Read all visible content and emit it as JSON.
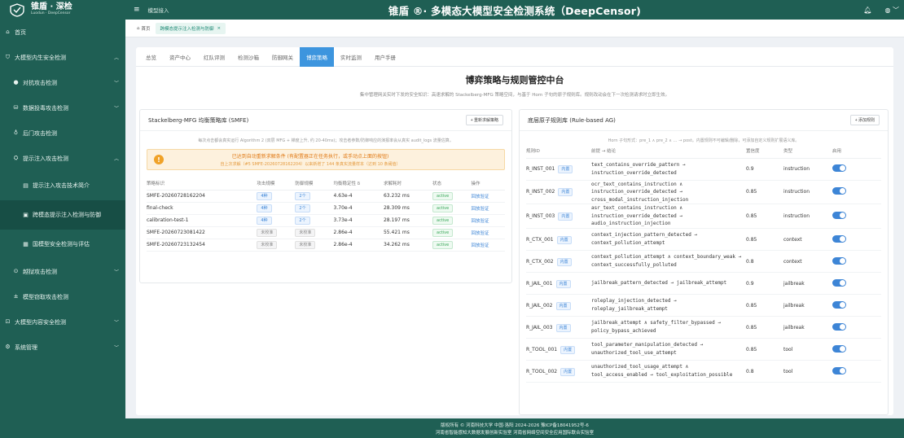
{
  "logo": {
    "title": "锥盾 · 深检",
    "subtitle": "Luodun · DeepCensor"
  },
  "sidebar": {
    "items": [
      {
        "label": "首页",
        "icon": "home-icon"
      },
      {
        "label": "大模型内生安全检测",
        "icon": "shield-icon"
      },
      {
        "label": "对抗攻击检测",
        "icon": "target-icon"
      },
      {
        "label": "数据投毒攻击检测",
        "icon": "database-icon"
      },
      {
        "label": "后门攻击检测",
        "icon": "backdoor-icon"
      },
      {
        "label": "提示注入攻击检测",
        "icon": "inject-icon"
      },
      {
        "label": "提示注入攻击技术简介",
        "icon": "doc-icon"
      },
      {
        "label": "跨模态提示注入检测与防御",
        "icon": "monitor-icon"
      },
      {
        "label": "国模型安全检测与评估",
        "icon": "grid-icon"
      },
      {
        "label": "越狱攻击检测",
        "icon": "lock-icon"
      },
      {
        "label": "模型窃取攻击检测",
        "icon": "steal-icon"
      },
      {
        "label": "大模型内容安全检测",
        "icon": "content-icon"
      },
      {
        "label": "系统管理",
        "icon": "settings-icon"
      }
    ]
  },
  "topbar": {
    "crumb": "模型接入",
    "title": "锥盾 ®· 多模态大模型安全检测系统（DeepCensor)"
  },
  "tabstrip": {
    "home": "首页",
    "active_tab": "跨模态提示注入检测与防御"
  },
  "navtabs": [
    "总览",
    "资产中心",
    "红队评测",
    "检测沙箱",
    "防御网关",
    "博弈策略",
    "实时监测",
    "用户手册"
  ],
  "section": {
    "title": "博弈策略与规则管控中台",
    "desc": "集中管理网关实时下发的安全知识：高速求解的 Stackelberg-MFG 策略空间，与基于 Horn 子句的原子规则库。规则改动会在下一次检测请求时立即生效。"
  },
  "left_panel": {
    "title": "Stackelberg-MFG 均衡策略库 (SMFE)",
    "button": "+ 重新求解策略",
    "note": "每次点击都会真实运行 Algorithm 2 (双层 MFG + 梯度上升, 约 20-40ms)；攻击者参数/防御响应的演报率会从真实 audit_logs 流量估算。",
    "alert_l1": "已达到自动重新求解条件 (有配置器正在任务执行，或手动点上面的按钮)",
    "alert_l2": "自上次求解（#5 SMFE-20260728162204）以来新增了 144 条真实流量样本（达到 10 条阈值）",
    "columns": [
      "策略标识",
      "攻击规模",
      "防御规模",
      "均衡稳定性 δ",
      "求解耗时",
      "状态",
      "操作"
    ],
    "rows": [
      {
        "id": "SMFE-20260728162204",
        "atk": "4种",
        "def": "2个",
        "delta": "4.63e-4",
        "time": "63.232 ms",
        "status": "active",
        "action": "回放验证",
        "atk_tag": "blue",
        "def_tag": "blue"
      },
      {
        "id": "final-check",
        "atk": "4种",
        "def": "2个",
        "delta": "3.70e-4",
        "time": "28.309 ms",
        "status": "active",
        "action": "回放验证",
        "atk_tag": "blue",
        "def_tag": "blue"
      },
      {
        "id": "calibration-test-1",
        "atk": "4种",
        "def": "2个",
        "delta": "3.73e-4",
        "time": "28.197 ms",
        "status": "active",
        "action": "回放验证",
        "atk_tag": "blue",
        "def_tag": "blue"
      },
      {
        "id": "SMFE-20260723081422",
        "atk": "未校准",
        "def": "未校准",
        "delta": "2.86e-4",
        "time": "55.421 ms",
        "status": "active",
        "action": "回放验证",
        "atk_tag": "gray",
        "def_tag": "gray"
      },
      {
        "id": "SMFE-20260723132454",
        "atk": "未校准",
        "def": "未校准",
        "delta": "2.86e-4",
        "time": "34.262 ms",
        "status": "active",
        "action": "回放验证",
        "atk_tag": "gray",
        "def_tag": "gray"
      }
    ]
  },
  "right_panel": {
    "title": "底层原子规则库 (Rule-based AG)",
    "button": "+ 添加规则",
    "note": "Horn 子句形式：pre_1 ∧ pre_2 ∧ … → post。内置规则不可编辑/删除，可添加自定义规则扩展语义库。",
    "columns": [
      "规则ID",
      "前提 → 结论",
      "置信度",
      "类型",
      "启用"
    ],
    "builtin_label": "内置",
    "rows": [
      {
        "id": "R_INST_001",
        "cond": "text_contains_override_pattern → instruction_override_detected",
        "conf": "0.9",
        "type": "instruction"
      },
      {
        "id": "R_INST_002",
        "cond": "ocr_text_contains_instruction ∧ instruction_override_detected → cross_modal_instruction_injection",
        "conf": "0.85",
        "type": "instruction"
      },
      {
        "id": "R_INST_003",
        "cond": "asr_text_contains_instruction ∧ instruction_override_detected → audio_instruction_injection",
        "conf": "0.85",
        "type": "instruction"
      },
      {
        "id": "R_CTX_001",
        "cond": "context_injection_pattern_detected → context_pollution_attempt",
        "conf": "0.85",
        "type": "context"
      },
      {
        "id": "R_CTX_002",
        "cond": "context_pollution_attempt ∧ context_boundary_weak → context_successfully_polluted",
        "conf": "0.8",
        "type": "context"
      },
      {
        "id": "R_JAIL_001",
        "cond": "jailbreak_pattern_detected → jailbreak_attempt",
        "conf": "0.9",
        "type": "jailbreak"
      },
      {
        "id": "R_JAIL_002",
        "cond": "roleplay_injection_detected → roleplay_jailbreak_attempt",
        "conf": "0.85",
        "type": "jailbreak"
      },
      {
        "id": "R_JAIL_003",
        "cond": "jailbreak_attempt ∧ safety_filter_bypassed → policy_bypass_achieved",
        "conf": "0.85",
        "type": "jailbreak"
      },
      {
        "id": "R_TOOL_001",
        "cond": "tool_parameter_manipulation_detected → unauthorized_tool_use_attempt",
        "conf": "0.85",
        "type": "tool"
      },
      {
        "id": "R_TOOL_002",
        "cond": "unauthorized_tool_usage_attempt ∧ tool_access_enabled → tool_exploitation_possible",
        "conf": "0.8",
        "type": "tool"
      }
    ]
  },
  "footer": {
    "l1": "版权所有 © 河南科技大学  中国·洛阳  2024-2026  豫ICP备18041952号-6",
    "l2": "河南省智能感知大数据发展创新实验室  河南省网络空间安全应用国际联合实验室"
  },
  "colors": {
    "primary": "#1f5f54",
    "accent": "#3d95de",
    "warn": "#f0a228"
  }
}
